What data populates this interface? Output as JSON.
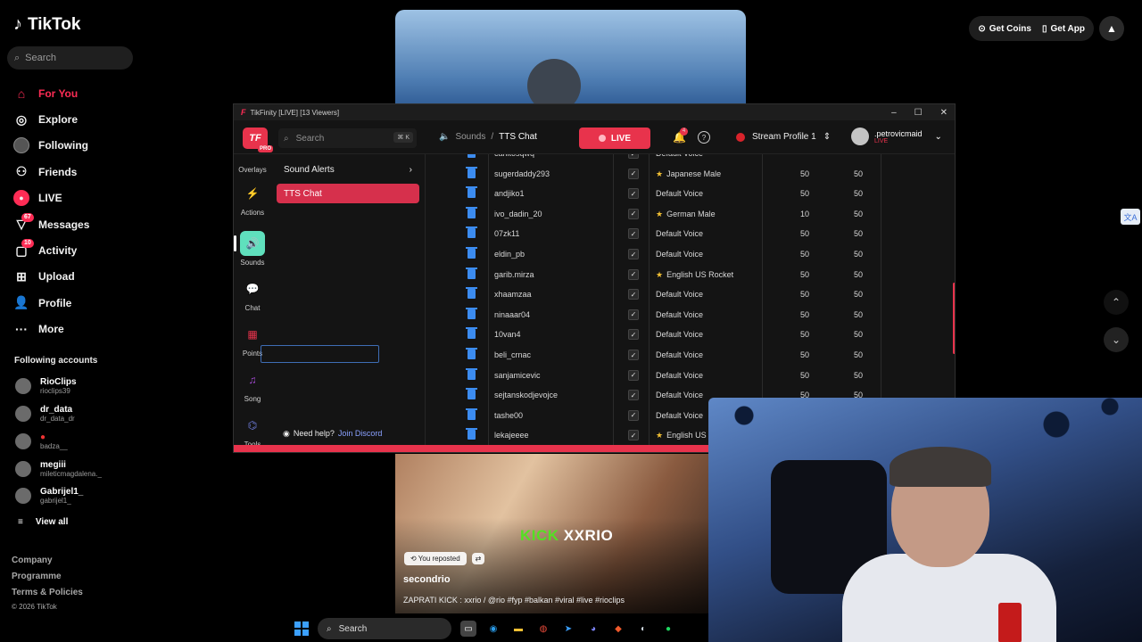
{
  "tiktok": {
    "brand": "TikTok",
    "search_placeholder": "Search",
    "nav": [
      {
        "label": "For You",
        "icon": "home-icon"
      },
      {
        "label": "Explore",
        "icon": "compass-icon"
      },
      {
        "label": "Following",
        "icon": "avatar-icon"
      },
      {
        "label": "Friends",
        "icon": "friends-icon"
      },
      {
        "label": "LIVE",
        "icon": "live-icon"
      },
      {
        "label": "Messages",
        "icon": "messages-icon",
        "badge": "67"
      },
      {
        "label": "Activity",
        "icon": "activity-icon",
        "badge": "10"
      },
      {
        "label": "Upload",
        "icon": "upload-icon"
      },
      {
        "label": "Profile",
        "icon": "profile-icon"
      },
      {
        "label": "More",
        "icon": "more-icon"
      }
    ],
    "following_title": "Following accounts",
    "following": [
      {
        "name": "RioClips",
        "handle": "rioclips39"
      },
      {
        "name": "dr_data",
        "handle": "dr_data_dr"
      },
      {
        "name": "",
        "handle": "badza__"
      },
      {
        "name": "megiii",
        "handle": "mileticmagdalena._"
      },
      {
        "name": "Gabrijel1_",
        "handle": "gabrijel1_"
      }
    ],
    "view_all": "View all",
    "footer": [
      "Company",
      "Programme",
      "Terms & Policies",
      "© 2026 TikTok"
    ],
    "get_coins": "Get Coins",
    "get_app": "Get App",
    "video": {
      "overlay_kick": "KICK",
      "overlay_name": "XXRIO",
      "reposted": "You reposted",
      "author": "secondrio",
      "caption": "ZAPRATI KICK : xxrio / @rio #fyp #balkan #viral #live #rioclips"
    },
    "accent": "#fe2c55"
  },
  "tikfinity": {
    "window_title": "TikFinity [LIVE] [13 Viewers]",
    "logo": "TF",
    "pro": "PRO",
    "search_placeholder": "Search",
    "search_kbd": "⌘ K",
    "breadcrumb_parent": "Sounds",
    "breadcrumb_sep": "/",
    "breadcrumb_current": "TTS Chat",
    "live_label": "LIVE",
    "notif_count": "4",
    "profile_label": "Stream Profile 1",
    "username": ".petrovicmaid",
    "user_status": "LIVE",
    "left_nav": [
      {
        "label": "Overlays"
      },
      {
        "label": "Actions"
      },
      {
        "label": "Sounds"
      },
      {
        "label": "Chat"
      },
      {
        "label": "Points"
      },
      {
        "label": "Song"
      },
      {
        "label": "Tools"
      }
    ],
    "sub_nav": [
      {
        "label": "Sound Alerts",
        "chevron": "›"
      },
      {
        "label": "TTS Chat",
        "chevron": ""
      }
    ],
    "help_text": "Need help?",
    "help_link": "Join Discord",
    "rows": [
      {
        "user": "canitosqwq",
        "voice": "Default Voice",
        "star": false,
        "a": "",
        "b": ""
      },
      {
        "user": "sugerdaddy293",
        "voice": "Japanese Male",
        "star": true,
        "a": "50",
        "b": "50"
      },
      {
        "user": "andjiko1",
        "voice": "Default Voice",
        "star": false,
        "a": "50",
        "b": "50"
      },
      {
        "user": "ivo_dadin_20",
        "voice": "German Male",
        "star": true,
        "a": "10",
        "b": "50"
      },
      {
        "user": "07zk11",
        "voice": "Default Voice",
        "star": false,
        "a": "50",
        "b": "50"
      },
      {
        "user": "eldin_pb",
        "voice": "Default Voice",
        "star": false,
        "a": "50",
        "b": "50"
      },
      {
        "user": "garib.mirza",
        "voice": "English US Rocket",
        "star": true,
        "a": "50",
        "b": "50"
      },
      {
        "user": "xhaamzaa",
        "voice": "Default Voice",
        "star": false,
        "a": "50",
        "b": "50"
      },
      {
        "user": "ninaaar04",
        "voice": "Default Voice",
        "star": false,
        "a": "50",
        "b": "50"
      },
      {
        "user": "10van4",
        "voice": "Default Voice",
        "star": false,
        "a": "50",
        "b": "50"
      },
      {
        "user": "beli_crnac",
        "voice": "Default Voice",
        "star": false,
        "a": "50",
        "b": "50"
      },
      {
        "user": "sanjamicevic",
        "voice": "Default Voice",
        "star": false,
        "a": "50",
        "b": "50"
      },
      {
        "user": "sejtanskodjevojce",
        "voice": "Default Voice",
        "star": false,
        "a": "50",
        "b": "50"
      },
      {
        "user": "tashe00",
        "voice": "Default Voice",
        "star": false,
        "a": "",
        "b": ""
      },
      {
        "user": "lekajeeee",
        "voice": "English US",
        "star": true,
        "a": "",
        "b": ""
      }
    ],
    "accent": "#e8334c"
  },
  "taskbar": {
    "search_placeholder": "Search"
  }
}
